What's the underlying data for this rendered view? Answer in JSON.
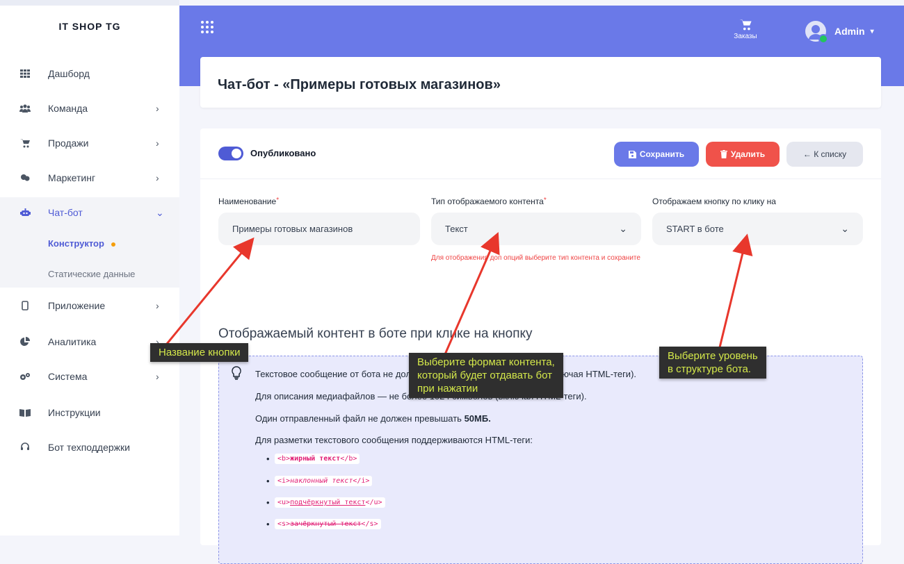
{
  "brand": "IT SHOP TG",
  "sidebar": {
    "items": [
      {
        "label": "Дашборд",
        "icon": "dashboard-grid-icon",
        "has_chevron": false
      },
      {
        "label": "Команда",
        "icon": "team-icon",
        "has_chevron": true
      },
      {
        "label": "Продажи",
        "icon": "cart-icon",
        "has_chevron": true
      },
      {
        "label": "Маркетинг",
        "icon": "marketing-icon",
        "has_chevron": true
      },
      {
        "label": "Чат-бот",
        "icon": "robot-icon",
        "has_chevron": true,
        "expanded": true
      },
      {
        "label": "Приложение",
        "icon": "mobile-icon",
        "has_chevron": true
      },
      {
        "label": "Аналитика",
        "icon": "analytics-icon",
        "has_chevron": true
      },
      {
        "label": "Система",
        "icon": "gears-icon",
        "has_chevron": true
      },
      {
        "label": "Инструкции",
        "icon": "book-icon",
        "has_chevron": false
      },
      {
        "label": "Бот техподдержки",
        "icon": "headset-icon",
        "has_chevron": false
      }
    ],
    "sub_items": [
      {
        "label": "Конструктор",
        "active": true
      },
      {
        "label": "Статические данные",
        "active": false
      }
    ]
  },
  "header": {
    "orders_label": "Заказы",
    "user_name": "Admin"
  },
  "page": {
    "title": "Чат-бот - «Примеры готовых магазинов»"
  },
  "form": {
    "published_label": "Опубликовано",
    "published": true,
    "save_label": "Сохранить",
    "delete_label": "Удалить",
    "back_label": "← К списку",
    "name_label": "Наименование",
    "name_value": "Примеры готовых магазинов",
    "content_type_label": "Тип отображаемого контента",
    "content_type_value": "Текст",
    "content_type_hint": "Для отображения доп опций выберите тип контента и сохраните",
    "trigger_label": "Отображаем кнопку по клику на",
    "trigger_value": "START в боте"
  },
  "content": {
    "section_title": "Отображаемый контент в боте при клике на кнопку",
    "info_lines": [
      "Текстовое сообщение от бота не должно превышать 4096 символов (включая HTML-теги).",
      "Для описания медиафайлов — не более 1024 символов (включая HTML-теги).",
      "Один отправленный файл не должен превышать",
      "Для разметки текстового сообщения поддерживаются HTML-теги:"
    ],
    "file_limit": "50МБ.",
    "tags": [
      {
        "open": "<b>",
        "text": "жирный текст",
        "close": "</b>"
      },
      {
        "open": "<i>",
        "text": "наклонный текст",
        "close": "</i>"
      },
      {
        "open": "<u>",
        "text": "подчёркнутый текст",
        "close": "</u>"
      },
      {
        "open": "<s>",
        "text": "зачёркнутый текст",
        "close": "</s>"
      }
    ]
  },
  "callouts": {
    "name": "Название кнопки",
    "format_line1": "Выберите формат контента,",
    "format_line2": "который будет отдавать бот",
    "format_line3": "при нажатии",
    "level_line1": "Выберите уровень",
    "level_line2": "в структуре бота."
  },
  "colors": {
    "accent": "#6a79e8",
    "danger": "#f0524a",
    "annotation_arrow": "#e8372c",
    "annotation_text": "#d4e84a"
  }
}
